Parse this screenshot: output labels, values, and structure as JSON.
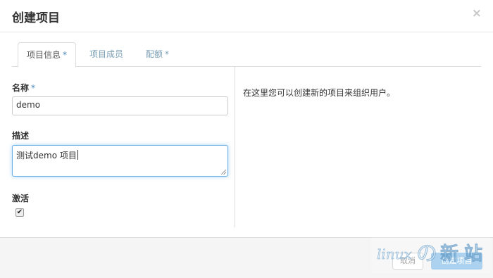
{
  "dialog": {
    "title": "创建项目",
    "close_glyph": "×"
  },
  "tabs": [
    {
      "label": "项目信息",
      "required_mark": "*"
    },
    {
      "label": "项目成员",
      "required_mark": ""
    },
    {
      "label": "配额",
      "required_mark": "*"
    }
  ],
  "form": {
    "name_label": "名称",
    "name_required_mark": "*",
    "name_value": "demo",
    "description_label": "描述",
    "description_value": "测试demo 项目",
    "enabled_label": "激活",
    "enabled_checked": true,
    "enabled_glyph": "✔"
  },
  "help_text": "在这里您可以创建新的项目来组织用户。",
  "footer": {
    "cancel_label": "取消",
    "submit_label": "创建项目"
  },
  "watermark": {
    "text": "linux の 新 站"
  },
  "colors": {
    "accent": "#66afe9",
    "tab_link": "#7a9eb5",
    "primary_button": "#8fc3ea"
  }
}
